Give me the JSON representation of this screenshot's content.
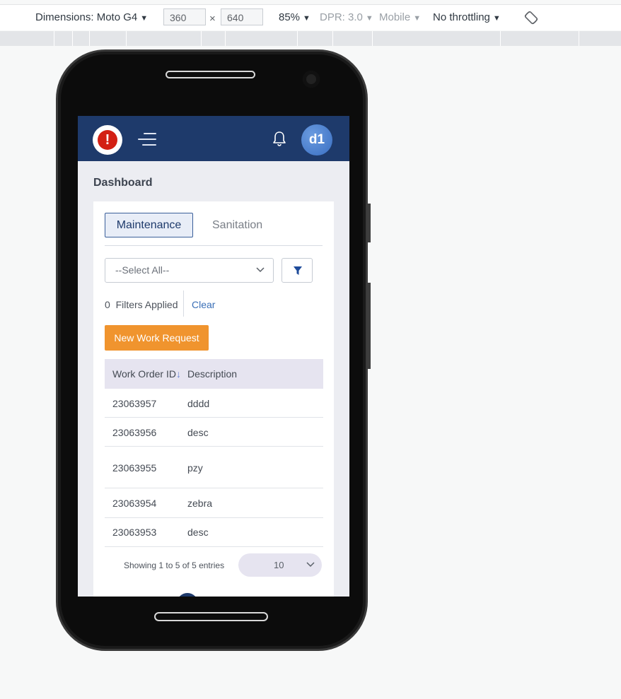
{
  "devtools": {
    "dimensions_label": "Dimensions: Moto G4",
    "width_value": "360",
    "times": "×",
    "height_value": "640",
    "zoom": "85%",
    "dpr": "DPR: 3.0",
    "mode": "Mobile",
    "throttling": "No throttling",
    "icons": [
      "caret-down-icon",
      "rotate-icon"
    ]
  },
  "app": {
    "header": {
      "avatar_text": "d1",
      "logo_mark": "!",
      "icons": [
        "alert-logo-icon",
        "hamburger-menu-icon",
        "bell-icon"
      ]
    },
    "page_title": "Dashboard",
    "tabs": [
      {
        "label": "Maintenance",
        "active": true
      },
      {
        "label": "Sanitation",
        "active": false
      }
    ],
    "filter_select": {
      "value": "--Select All--"
    },
    "filters_applied": "0  Filters Applied",
    "clear_label": "Clear",
    "new_request_label": "New Work Request",
    "table": {
      "headers": [
        "Work Order ID",
        "Description"
      ],
      "sort_glyph": "↓",
      "rows": [
        {
          "id": "23063957",
          "desc": "dddd"
        },
        {
          "id": "23063956",
          "desc": "desc"
        },
        {
          "id": "23063955",
          "desc": "pzy"
        },
        {
          "id": "23063954",
          "desc": "zebra"
        },
        {
          "id": "23063953",
          "desc": "desc"
        }
      ]
    },
    "showing_text": "Showing 1 to 5 of 5 entries",
    "page_size": "10",
    "colors": {
      "appbar": "#1e3a6b",
      "accent": "#f0942e",
      "tab_border": "#3a5f9a"
    }
  }
}
